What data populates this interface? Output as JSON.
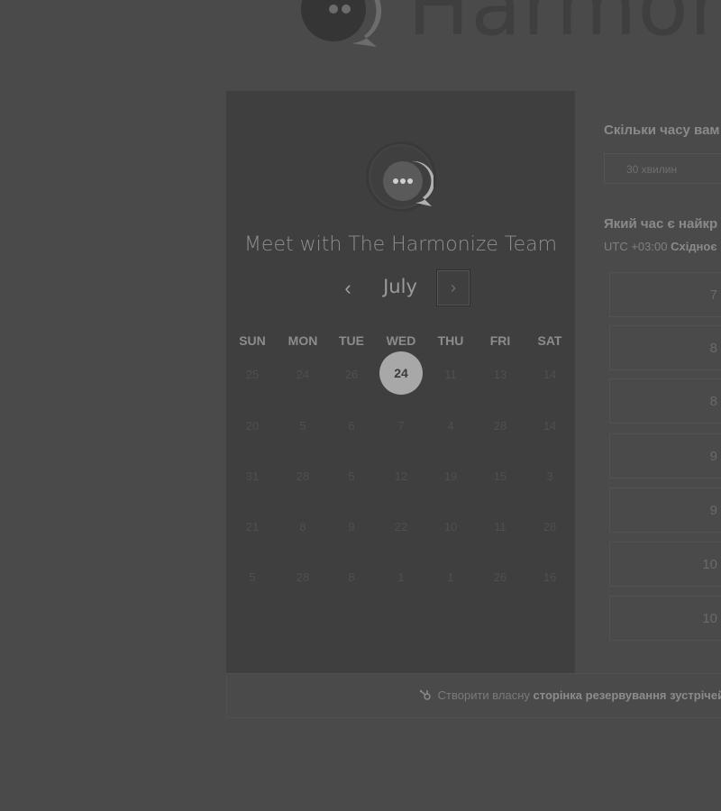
{
  "brand": {
    "name": "Harmon",
    "logo_icon": "chat-bubble-logo-icon"
  },
  "meeting": {
    "title": "Meet with The Harmonize Team"
  },
  "calendar": {
    "month": "July",
    "prev_label": "‹",
    "next_label": "›",
    "weekdays": [
      "SUN",
      "MON",
      "TUE",
      "WED",
      "THU",
      "FRI",
      "SAT"
    ],
    "weeks": [
      [
        "25",
        "24",
        "26",
        "24",
        "11",
        "13",
        "14"
      ],
      [
        "20",
        "5",
        "6",
        "7",
        "4",
        "28",
        "14"
      ],
      [
        "31",
        "28",
        "5",
        "12",
        "19",
        "15",
        "3"
      ],
      [
        "21",
        "8",
        "9",
        "22",
        "10",
        "11",
        "28"
      ],
      [
        "5",
        "28",
        "8",
        "1",
        "1",
        "26",
        "16"
      ]
    ],
    "selected_day": "24"
  },
  "duration": {
    "question": "Скільки часу вам",
    "value": "30 хвилин"
  },
  "time": {
    "question": "Який час є найкр",
    "tz_offset": "UTC +03:00",
    "tz_name": "Східноє"
  },
  "slots": [
    "7",
    "8",
    "8",
    "9",
    "9",
    "10",
    "10"
  ],
  "footer": {
    "prefix": "Створити власну",
    "bold": "сторінка резервування зустрічей"
  },
  "colors": {
    "background": "#4a4a4a",
    "panel": "#3f3f3f",
    "selected_day": "#a8a8a8"
  }
}
